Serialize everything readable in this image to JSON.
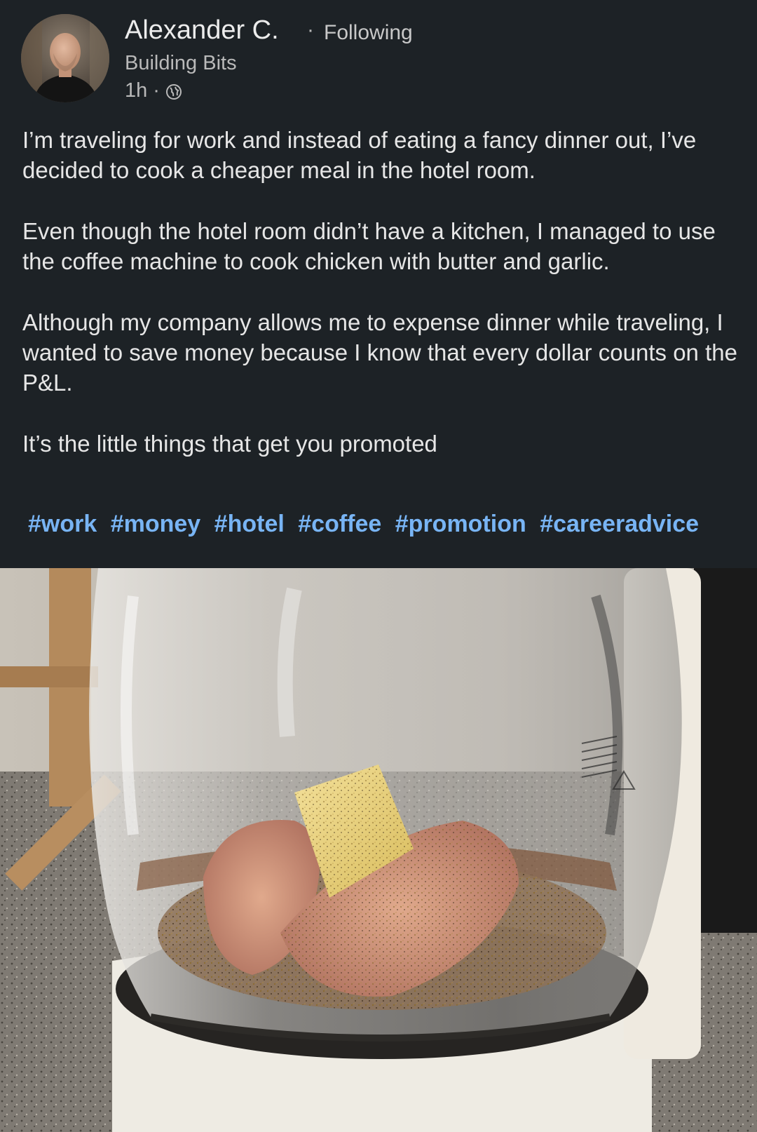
{
  "author": {
    "name": "Alexander C.",
    "separator": "·",
    "follow_status": "Following",
    "headline": "Building Bits",
    "time": "1h",
    "meta_separator": "·",
    "visibility_icon": "globe-icon"
  },
  "post": {
    "paragraphs": [
      "I’m traveling for work and instead of eating a fancy dinner out, I’ve decided to cook a cheaper meal in the hotel room.",
      "Even though the hotel room didn’t have a kitchen, I managed to use the coffee machine to cook chicken with butter and garlic.",
      "Although my company allows me to expense dinner while traveling, I wanted to save money because I know that every dollar counts on the P&L.",
      "It’s the little things that get you promoted"
    ],
    "hashtags": [
      "#work",
      "#money",
      "#hotel",
      "#coffee",
      "#promotion",
      "#careeradvice"
    ]
  },
  "colors": {
    "background": "#1d2226",
    "hashtag": "#78b4f4",
    "text": "#e6e6e6",
    "muted": "#b9b9b9"
  }
}
